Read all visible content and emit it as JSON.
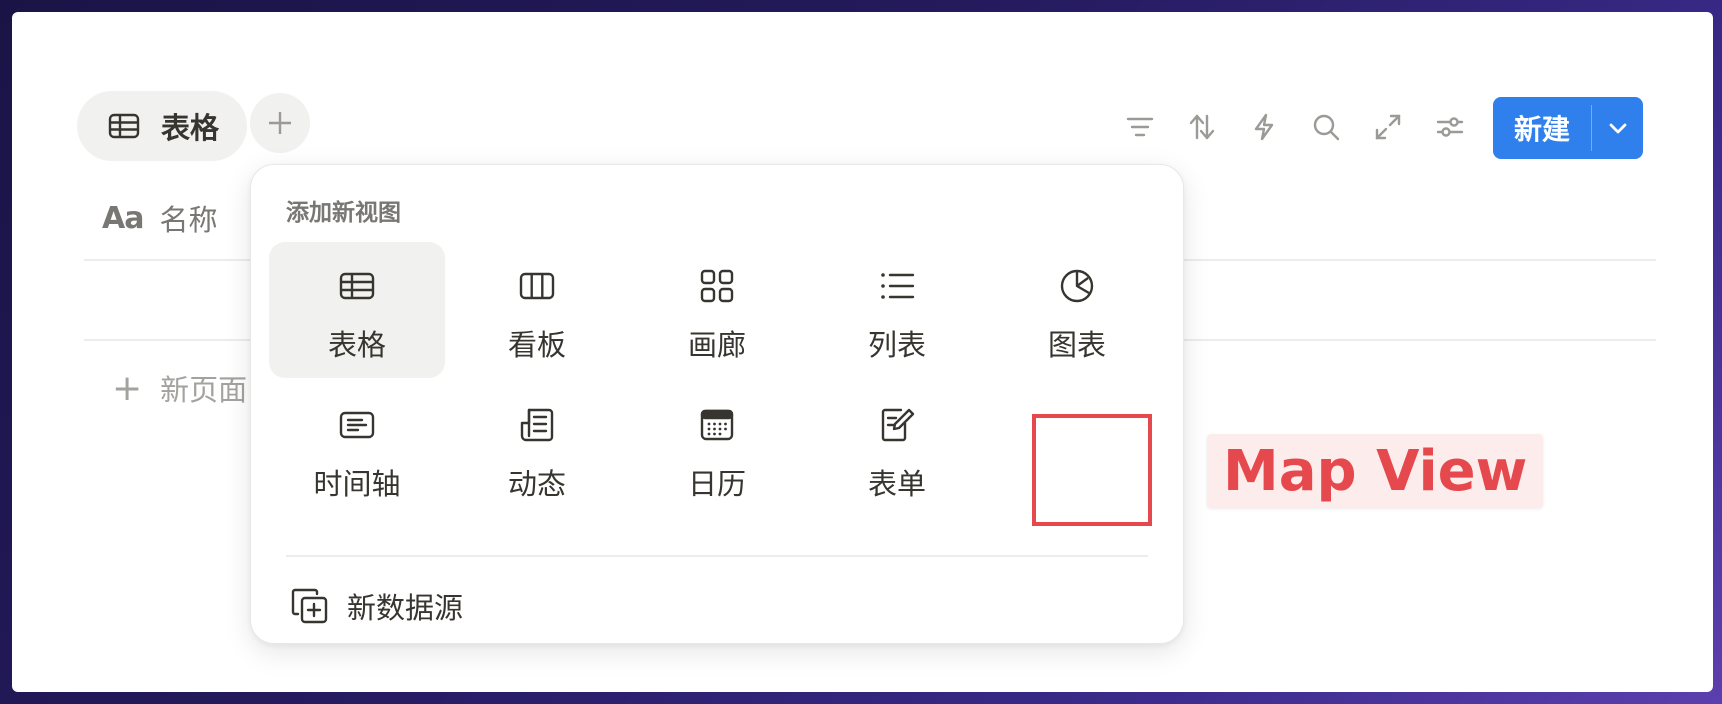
{
  "view_tab": {
    "label": "表格",
    "icon": "table-icon"
  },
  "toolbar": {
    "icons": [
      "filter-icon",
      "sort-icon",
      "automation-icon",
      "search-icon",
      "expand-icon",
      "settings-icon"
    ],
    "new_button_label": "新建"
  },
  "table": {
    "name_column_label": "名称",
    "new_page_label": "新页面"
  },
  "popup": {
    "title": "添加新视图",
    "options": [
      {
        "label": "表格",
        "icon": "table-icon",
        "selected": true
      },
      {
        "label": "看板",
        "icon": "board-icon"
      },
      {
        "label": "画廊",
        "icon": "gallery-icon"
      },
      {
        "label": "列表",
        "icon": "list-icon"
      },
      {
        "label": "图表",
        "icon": "chart-icon"
      },
      {
        "label": "时间轴",
        "icon": "timeline-icon"
      },
      {
        "label": "动态",
        "icon": "feed-icon"
      },
      {
        "label": "日历",
        "icon": "calendar-icon"
      },
      {
        "label": "表单",
        "icon": "form-icon"
      }
    ],
    "new_source_label": "新数据源"
  },
  "annotation": {
    "label": "Map View",
    "color": "#e5484d"
  },
  "colors": {
    "accent": "#2f80ed",
    "text": "#37352f",
    "muted": "#787774"
  }
}
